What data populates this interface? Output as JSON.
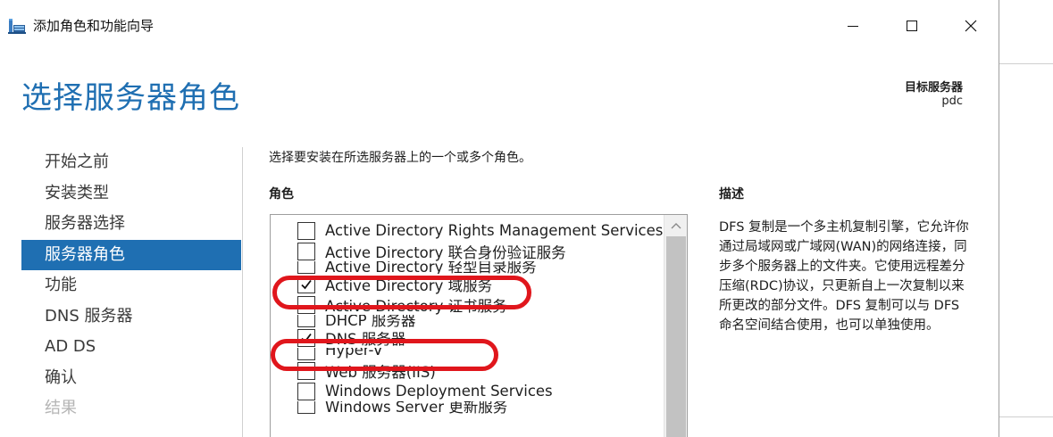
{
  "window": {
    "title": "添加角色和功能向导",
    "controls": {
      "minimize": "minimize",
      "maximize": "maximize",
      "close": "close"
    }
  },
  "header": {
    "page_title": "选择服务器角色",
    "target_label": "目标服务器",
    "target_value": "pdc"
  },
  "nav": {
    "items": [
      {
        "label": "开始之前",
        "state": "normal"
      },
      {
        "label": "安装类型",
        "state": "normal"
      },
      {
        "label": "服务器选择",
        "state": "normal"
      },
      {
        "label": "服务器角色",
        "state": "active"
      },
      {
        "label": "功能",
        "state": "normal"
      },
      {
        "label": "DNS 服务器",
        "state": "normal"
      },
      {
        "label": "AD DS",
        "state": "normal"
      },
      {
        "label": "确认",
        "state": "normal"
      },
      {
        "label": "结果",
        "state": "disabled"
      }
    ]
  },
  "content": {
    "instruction": "选择要安装在所选服务器上的一个或多个角色。",
    "roles_heading": "角色",
    "description_heading": "描述",
    "roles": [
      {
        "label": "Active Directory Rights Management Services",
        "checked": false
      },
      {
        "label": "Active Directory 联合身份验证服务",
        "checked": false
      },
      {
        "label": "Active Directory 轻型目录服务",
        "checked": false,
        "clipped": true
      },
      {
        "label": "Active Directory 域服务",
        "checked": true
      },
      {
        "label": "Active Directory 证书服务",
        "checked": false
      },
      {
        "label": "DHCP 服务器",
        "checked": false,
        "clipped": true
      },
      {
        "label": "DNS 服务器",
        "checked": true
      },
      {
        "label": "Hyper-V",
        "checked": false,
        "clipped": true
      },
      {
        "label": "Web 服务器(IIS)",
        "checked": false
      },
      {
        "label": "Windows Deployment Services",
        "checked": false
      },
      {
        "label": "Windows Server 更新服务",
        "checked": false,
        "clipped": true
      }
    ],
    "description": "DFS 复制是一个多主机复制引擎，它允许你通过局域网或广域网(WAN)的网络连接，同步多个服务器上的文件夹。它使用远程差分压缩(RDC)协议，只更新自上一次复制以来所更改的部分文件。DFS 复制可以与 DFS 命名空间结合使用，也可以单独使用。"
  },
  "colors": {
    "accent": "#1f6fb2",
    "annotation": "#e0161c"
  },
  "icons": {
    "app": "server-manager-icon",
    "checkmark": "checkmark-icon",
    "scroll_up": "chevron-up-icon"
  }
}
